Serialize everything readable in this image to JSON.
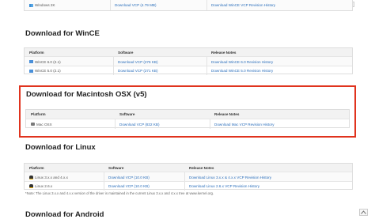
{
  "top": {
    "platform": "Windows 2K",
    "software": "Download VCP (4.79 MB)",
    "notes": "Download WinCE VCP Revision History"
  },
  "wince": {
    "title": "Download for WinCE",
    "headers": {
      "platform": "Platform",
      "software": "Software",
      "notes": "Release Notes"
    },
    "rows": [
      {
        "platform": "WinCE 6.0 (2.1)",
        "software": "Download VCP (276 KB)",
        "notes": "Download WinCE 6.0 Revision History"
      },
      {
        "platform": "WinCE 5.0 (2.1)",
        "software": "Download VCP (271 KB)",
        "notes": "Download WinCE 5.0 Revision History"
      }
    ]
  },
  "mac": {
    "title": "Download for Macintosh OSX (v5)",
    "headers": {
      "platform": "Platform",
      "software": "Software",
      "notes": "Release Notes"
    },
    "rows": [
      {
        "platform": "Mac OSX",
        "software": "Download VCP (832 KB)",
        "notes": "Download Mac VCP Revision History"
      }
    ]
  },
  "linux": {
    "title": "Download for Linux",
    "headers": {
      "platform": "Platform",
      "software": "Software",
      "notes": "Release Notes"
    },
    "rows": [
      {
        "platform": "Linux 3.x.x and 4.x.x",
        "software": "Download VCP (10.0 KB)",
        "notes": "Download Linux 3.x.x & 4.x.x VCP Revision History"
      },
      {
        "platform": "Linux 2.6.x",
        "software": "Download VCP (10.0 KB)",
        "notes": "Download Linux 2.6.x VCP Revision History"
      }
    ],
    "note": "*Note: The Linux 3.x.x and 4.x.x version of the driver is maintained in the current Linux 3.x.x and 4.x.x tree at www.kernel.org."
  },
  "android": {
    "title": "Download for Android"
  },
  "colors": {
    "highlight": "#e0331e",
    "link": "#2a6ebb"
  },
  "icons": {
    "windows": "windows-icon",
    "apple": "apple-icon",
    "linux": "tux-icon",
    "search": "search-icon",
    "up": "arrow-up-icon"
  }
}
